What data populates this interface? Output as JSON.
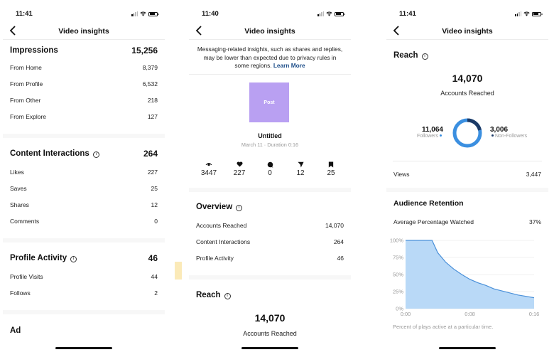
{
  "screens": [
    {
      "status": {
        "time": "11:41"
      },
      "nav": {
        "title": "Video insights",
        "back_icon": "chevron-left-icon"
      },
      "impressions": {
        "label": "Impressions",
        "value": "15,256",
        "rows": [
          {
            "label": "From Home",
            "value": "8,379"
          },
          {
            "label": "From Profile",
            "value": "6,532"
          },
          {
            "label": "From Other",
            "value": "218"
          },
          {
            "label": "From Explore",
            "value": "127"
          }
        ]
      },
      "content_interactions": {
        "label": "Content Interactions",
        "value": "264",
        "rows": [
          {
            "label": "Likes",
            "value": "227"
          },
          {
            "label": "Saves",
            "value": "25"
          },
          {
            "label": "Shares",
            "value": "12"
          },
          {
            "label": "Comments",
            "value": "0"
          }
        ]
      },
      "profile_activity": {
        "label": "Profile Activity",
        "value": "46",
        "rows": [
          {
            "label": "Profile Visits",
            "value": "44"
          },
          {
            "label": "Follows",
            "value": "2"
          }
        ]
      },
      "ad": {
        "label": "Ad"
      }
    },
    {
      "status": {
        "time": "11:40"
      },
      "nav": {
        "title": "Video insights",
        "back_icon": "chevron-left-icon"
      },
      "notice": {
        "text": "Messaging-related insights, such as shares and replies, may be lower than expected due to privacy rules in some regions.",
        "link": "Learn More"
      },
      "post": {
        "thumb_label": "Post",
        "thumb_color": "#b9a0f2",
        "title": "Untitled",
        "subtitle": "March 11 · Duration 0:16"
      },
      "metrics": [
        {
          "icon": "eye-icon",
          "value": "3447"
        },
        {
          "icon": "heart-icon",
          "value": "227"
        },
        {
          "icon": "comment-icon",
          "value": "0"
        },
        {
          "icon": "send-icon",
          "value": "12"
        },
        {
          "icon": "bookmark-icon",
          "value": "25"
        }
      ],
      "overview": {
        "label": "Overview",
        "rows": [
          {
            "label": "Accounts Reached",
            "value": "14,070"
          },
          {
            "label": "Content Interactions",
            "value": "264"
          },
          {
            "label": "Profile Activity",
            "value": "46"
          }
        ]
      },
      "reach": {
        "label": "Reach",
        "value": "14,070",
        "sub": "Accounts Reached"
      }
    },
    {
      "status": {
        "time": "11:41"
      },
      "nav": {
        "title": "Video insights",
        "back_icon": "chevron-left-icon"
      },
      "reach": {
        "label": "Reach",
        "value": "14,070",
        "sub": "Accounts Reached",
        "followers": {
          "value": "11,064",
          "label": "Followers",
          "color": "#3b8fe0"
        },
        "non_followers": {
          "value": "3,006",
          "label": "Non-Followers",
          "color": "#1c3a66"
        }
      },
      "views": {
        "label": "Views",
        "value": "3,447"
      },
      "retention": {
        "label": "Audience Retention",
        "avg_label": "Average Percentage Watched",
        "avg_value": "37%",
        "caption": "Percent of plays active at a particular time."
      }
    }
  ],
  "chart_data": {
    "type": "area",
    "title": "Audience Retention",
    "xlabel": "",
    "ylabel": "",
    "x_ticks": [
      "0:00",
      "0:08",
      "0:16"
    ],
    "y_ticks": [
      "0%",
      "25%",
      "50%",
      "75%",
      "100%"
    ],
    "xlim": [
      0,
      16
    ],
    "ylim": [
      0,
      100
    ],
    "grid": true,
    "x": [
      0,
      1,
      2,
      3,
      3.3,
      4,
      5,
      6,
      7,
      8,
      9,
      10,
      11,
      12,
      13,
      14,
      15,
      16
    ],
    "values": [
      100,
      100,
      100,
      100,
      100,
      82,
      68,
      58,
      50,
      43,
      38,
      34,
      29,
      26,
      23,
      20,
      18,
      16
    ],
    "color": "#4a90d9",
    "fill": "#b9d9f7"
  }
}
